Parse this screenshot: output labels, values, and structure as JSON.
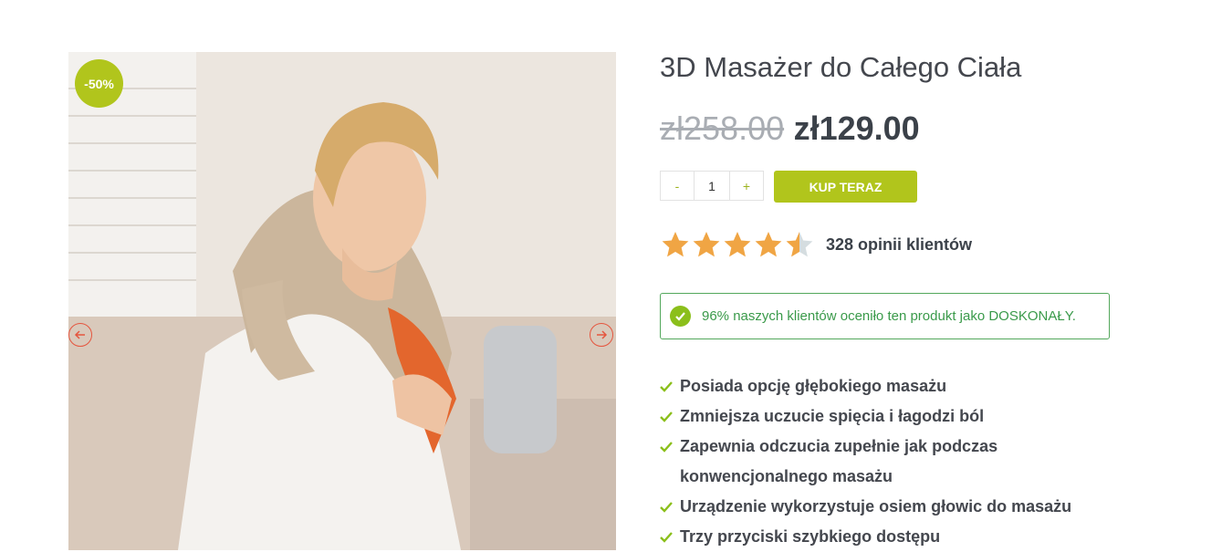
{
  "product": {
    "title": "3D Masażer do Całego Ciała",
    "old_price": "zł258.00",
    "new_price": "zł129.00",
    "sale_badge": "-50%"
  },
  "cart": {
    "minus_label": "-",
    "quantity": "1",
    "plus_label": "+",
    "buy_label": "KUP TERAZ"
  },
  "rating": {
    "stars": 4.5,
    "max_stars": 5,
    "reviews_text": "328 opinii klientów",
    "star_color": "#f0a544"
  },
  "notice": {
    "text": "96% naszych klientów oceniło ten produkt jako DOSKONAŁY.",
    "icon": "check-circle-icon"
  },
  "features": [
    "Posiada opcję głębokiego masażu",
    "Zmniejsza uczucie spięcia i łagodzi ból",
    "Zapewnia odczucia zupełnie jak podczas konwencjonalnego masażu",
    "Urządzenie wykorzystuje osiem głowic do masażu",
    "Trzy przyciski szybkiego dostępu"
  ],
  "gallery": {
    "prev_icon": "arrow-left-icon",
    "next_icon": "arrow-right-icon"
  },
  "colors": {
    "accent": "#b1c51c",
    "arrow": "#e5553e",
    "notice_border": "#53a85c"
  }
}
